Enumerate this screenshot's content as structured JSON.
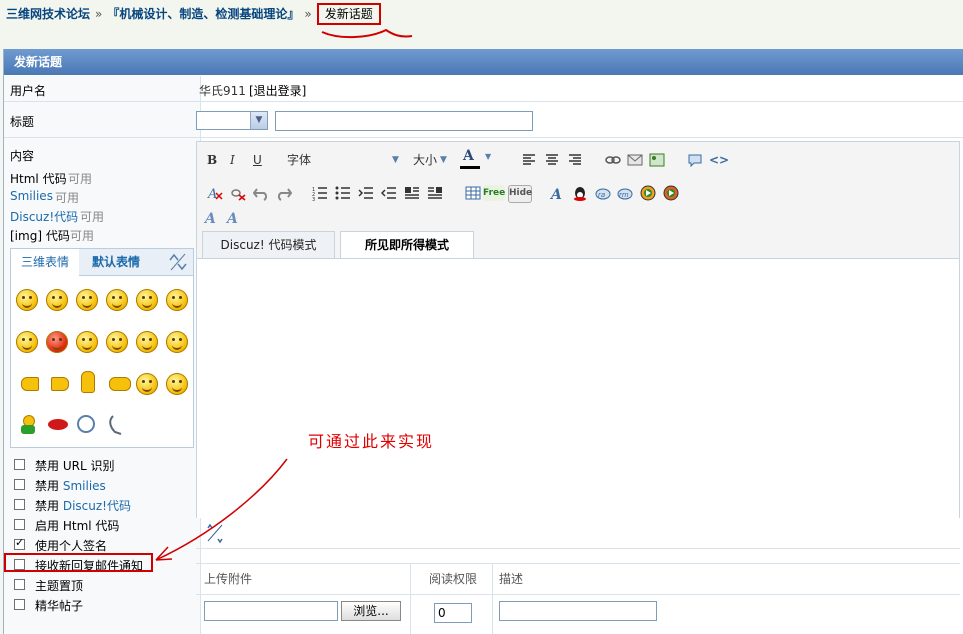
{
  "breadcrumb": {
    "items": [
      "三维网技术论坛",
      "『机械设计、制造、检测基础理论』"
    ],
    "separator": "»",
    "current": "发新话题"
  },
  "form": {
    "header": "发新话题",
    "username_label": "用户名",
    "username_value": "华氏911",
    "logout_link": "[退出登录]",
    "title_label": "标题",
    "content_label": "内容",
    "html_code": {
      "label": "Html 代码",
      "status": "可用"
    },
    "smilies": {
      "label": "Smilies",
      "status": "可用"
    },
    "discuz_code": {
      "label": "Discuz!代码",
      "status": "可用"
    },
    "img_code": {
      "label": "[img] 代码",
      "status": "可用"
    }
  },
  "smilies_panel": {
    "tabs": [
      "三维表情",
      "默认表情"
    ]
  },
  "editor": {
    "toolbar": {
      "bold": "B",
      "italic": "I",
      "underline": "U",
      "font": "字体",
      "size": "大小",
      "forecolor": "A",
      "free": "Free",
      "hide": "Hide"
    },
    "tabs": [
      "Discuz! 代码模式",
      "所见即所得模式"
    ],
    "active_tab": 1
  },
  "options": [
    {
      "label": "禁用",
      "value": "URL 识别",
      "checked": false
    },
    {
      "label": "禁用",
      "value": "Smilies",
      "checked": false
    },
    {
      "label": "禁用",
      "value": "Discuz!代码",
      "checked": false
    },
    {
      "label": "启用",
      "value": "Html 代码",
      "checked": false
    },
    {
      "label": "使用个人签名",
      "value": "",
      "checked": true
    },
    {
      "label": "接收新回复邮件通知",
      "value": "",
      "checked": false
    },
    {
      "label": "主题置顶",
      "value": "",
      "checked": false
    },
    {
      "label": "精华帖子",
      "value": "",
      "checked": false
    }
  ],
  "attachments": {
    "upload_header": "上传附件",
    "permission_header": "阅读权限",
    "description_header": "描述",
    "browse_label": "浏览...",
    "permission_value": "0"
  },
  "annotation": {
    "text": "可通过此来实现",
    "color": "#e00000"
  },
  "colors": {
    "header_bg": "#5a86c2",
    "link": "#1b6aab",
    "highlight": "#d00000"
  }
}
